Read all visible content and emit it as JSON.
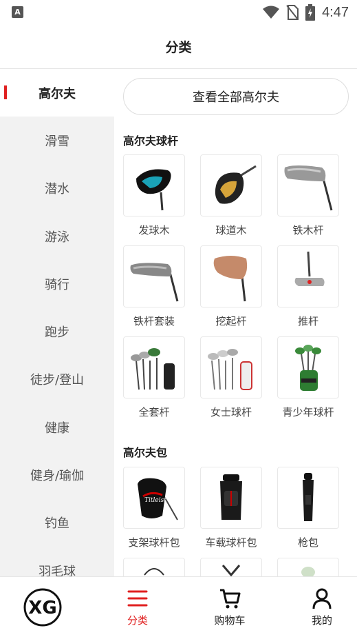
{
  "status_bar": {
    "time": "4:47",
    "app_badge": "A"
  },
  "header": {
    "title": "分类"
  },
  "sidebar": {
    "items": [
      {
        "label": "高尔夫",
        "active": true
      },
      {
        "label": "滑雪"
      },
      {
        "label": "潜水"
      },
      {
        "label": "游泳"
      },
      {
        "label": "骑行"
      },
      {
        "label": "跑步"
      },
      {
        "label": "徒步/登山"
      },
      {
        "label": "健康"
      },
      {
        "label": "健身/瑜伽"
      },
      {
        "label": "钓鱼"
      },
      {
        "label": "羽毛球"
      }
    ]
  },
  "content": {
    "view_all": "查看全部高尔夫",
    "sections": [
      {
        "title": "高尔夫球杆",
        "items": [
          {
            "label": "发球木",
            "icon": "driver-icon"
          },
          {
            "label": "球道木",
            "icon": "fairway-wood-icon"
          },
          {
            "label": "铁木杆",
            "icon": "hybrid-iron-icon"
          },
          {
            "label": "铁杆套装",
            "icon": "iron-set-icon"
          },
          {
            "label": "挖起杆",
            "icon": "wedge-icon"
          },
          {
            "label": "推杆",
            "icon": "putter-icon"
          },
          {
            "label": "全套杆",
            "icon": "full-set-icon"
          },
          {
            "label": "女士球杆",
            "icon": "womens-clubs-icon"
          },
          {
            "label": "青少年球杆",
            "icon": "junior-clubs-icon"
          }
        ]
      },
      {
        "title": "高尔夫包",
        "items": [
          {
            "label": "支架球杆包",
            "icon": "stand-bag-icon"
          },
          {
            "label": "车载球杆包",
            "icon": "cart-bag-icon"
          },
          {
            "label": "枪包",
            "icon": "pencil-bag-icon"
          }
        ]
      }
    ]
  },
  "tabbar": {
    "items": [
      {
        "label": "",
        "icon": "xg-logo-icon"
      },
      {
        "label": "分类",
        "icon": "menu-icon",
        "active": true
      },
      {
        "label": "购物车",
        "icon": "cart-icon"
      },
      {
        "label": "我的",
        "icon": "user-icon"
      }
    ]
  },
  "colors": {
    "accent": "#e02020",
    "sidebar_bg": "#f2f2f2"
  }
}
